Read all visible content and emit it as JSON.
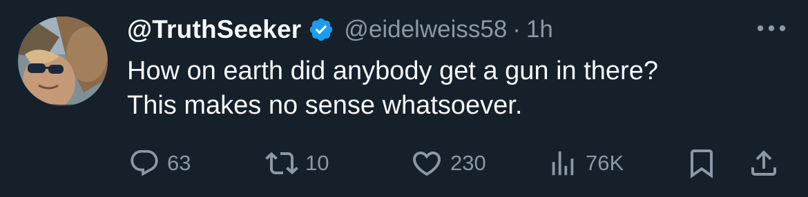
{
  "user": {
    "display_name": "@TruthSeeker",
    "handle": "@eidelweiss58",
    "separator": "·",
    "time": "1h",
    "verified": true,
    "avatar_icon": "avatar-photo"
  },
  "tweet": {
    "lines": [
      "How on earth did anybody get a gun in there?",
      "This makes no sense whatsoever."
    ]
  },
  "actions": {
    "reply": {
      "icon": "reply-icon",
      "count": "63"
    },
    "retweet": {
      "icon": "retweet-icon",
      "count": "10"
    },
    "like": {
      "icon": "heart-icon",
      "count": "230"
    },
    "views": {
      "icon": "views-icon",
      "count": "76K"
    },
    "bookmark": {
      "icon": "bookmark-icon"
    },
    "share": {
      "icon": "share-icon"
    }
  },
  "colors": {
    "background": "#15202b",
    "text": "#f7f9f9",
    "muted": "#8b98a5",
    "verified": "#1d9bf0"
  }
}
